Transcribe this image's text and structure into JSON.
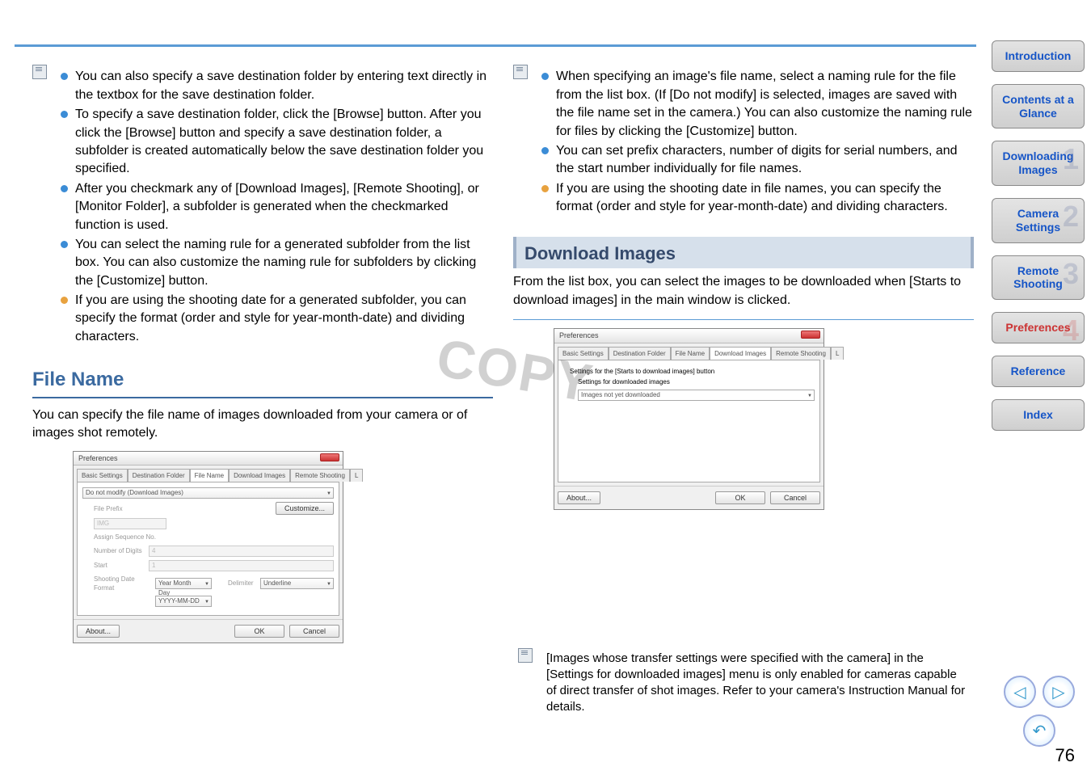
{
  "left": {
    "bullets": [
      "You can also specify a save destination folder by entering text directly in the textbox for the save destination folder.",
      "To specify a save destination folder, click the [Browse] button. After you click the [Browse] button and specify a save destination folder, a subfolder is created automatically below the save destination folder you specified.",
      "After you checkmark any of [Download Images], [Remote Shooting], or [Monitor Folder], a subfolder is generated when the checkmarked function is used.",
      "You can select the naming rule for a generated subfolder from the list box. You can also customize the naming rule for subfolders by clicking the [Customize] button.",
      "If you are using the shooting date for a generated subfolder, you can specify the format (order and style for year-month-date) and dividing characters."
    ],
    "section_title": "File Name",
    "section_intro": "You can specify the file name of images downloaded from your camera or of images shot remotely.",
    "dialog": {
      "title": "Preferences",
      "tabs": [
        "Basic Settings",
        "Destination Folder",
        "File Name",
        "Download Images",
        "Remote Shooting",
        "L"
      ],
      "active_tab": "File Name",
      "rule_select": "Do not modify (Download Images)",
      "file_prefix_label": "File Prefix",
      "file_prefix_value": "IMG",
      "assign_seq_label": "Assign Sequence No.",
      "digits_label": "Number of Digits",
      "digits_value": "4",
      "start_label": "Start",
      "start_value": "1",
      "date_format_label": "Shooting Date Format",
      "date_format_select": "Year Month Day",
      "date_fmt_select": "YYYY-MM-DD",
      "delimiter_label": "Delimiter",
      "delimiter_select": "Underline",
      "customize_btn": "Customize...",
      "about_btn": "About...",
      "ok_btn": "OK",
      "cancel_btn": "Cancel"
    }
  },
  "right": {
    "bullets": [
      "When specifying an image's file name, select a naming rule for the file from the list box. (If [Do not modify] is selected, images are saved with the file name set in the camera.) You can also customize the naming rule for files by clicking the [Customize] button.",
      "You can set prefix characters, number of digits for serial numbers, and the start number individually for file names.",
      "If you are using the shooting date in file names, you can specify the format (order and style for year-month-date) and dividing characters."
    ],
    "sub_header": "Download Images",
    "sub_intro": "From the list box, you can select the images to be downloaded when [Starts to download images] in the main window is clicked.",
    "dialog": {
      "title": "Preferences",
      "tabs": [
        "Basic Settings",
        "Destination Folder",
        "File Name",
        "Download Images",
        "Remote Shooting",
        "L"
      ],
      "active_tab": "Download Images",
      "heading1": "Settings for the [Starts to download images] button",
      "heading2": "Settings for downloaded images",
      "select_value": "Images not yet downloaded",
      "about_btn": "About...",
      "ok_btn": "OK",
      "cancel_btn": "Cancel"
    },
    "note": "[Images whose transfer settings were specified with the camera] in the [Settings for downloaded images] menu is only enabled for cameras capable of direct transfer of shot images. Refer to your camera's Instruction Manual for details."
  },
  "nav": {
    "introduction": "Introduction",
    "contents": "Contents at a Glance",
    "download": "Downloading Images",
    "camera": "Camera Settings",
    "remote": "Remote Shooting",
    "prefs": "Preferences",
    "reference": "Reference",
    "index": "Index"
  },
  "watermark": "COPY",
  "page_number": "76"
}
